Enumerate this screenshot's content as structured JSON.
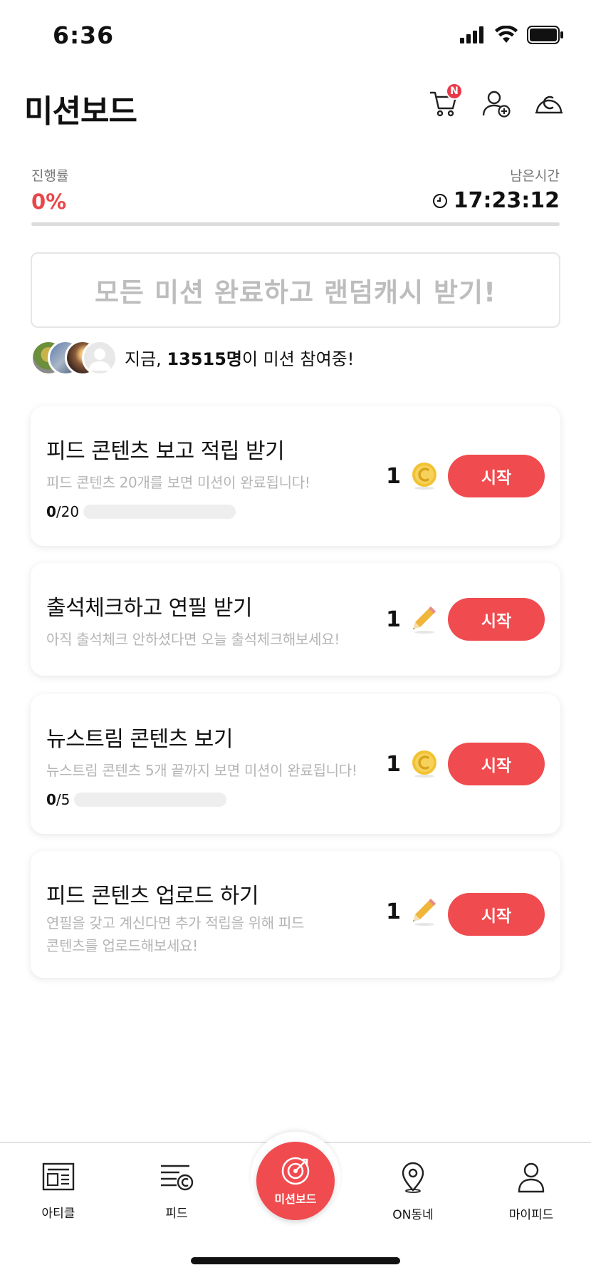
{
  "status_bar": {
    "time": "6:36"
  },
  "header": {
    "title": "미션보드",
    "cart_badge": "N"
  },
  "progress": {
    "label": "진행률",
    "value": "0%",
    "fraction": 0,
    "remaining_label": "남은시간",
    "remaining_time": "17:23:12"
  },
  "banner": {
    "text": "모든 미션 완료하고 랜덤캐시 받기!"
  },
  "participants": {
    "prefix": "지금, ",
    "count": "13515명",
    "suffix": "이 미션 참여중!"
  },
  "missions": [
    {
      "title": "피드 콘텐츠 보고 적립 받기",
      "desc": "피드 콘텐츠 20개를 보면 미션이 완료됩니다!",
      "progress_current": "0",
      "progress_total": "/20",
      "reward_amount": "1",
      "reward_icon": "coin-icon",
      "button": "시작"
    },
    {
      "title": "출석체크하고 연필 받기",
      "desc": "아직 출석체크 안하셨다면 오늘 출석체크해보세요!",
      "reward_amount": "1",
      "reward_icon": "pencil-icon",
      "button": "시작"
    },
    {
      "title": "뉴스트림 콘텐츠 보기",
      "desc": "뉴스트림 콘텐츠 5개 끝까지 보면 미션이 완료됩니다!",
      "progress_current": "0",
      "progress_total": "/5",
      "reward_amount": "1",
      "reward_icon": "coin-icon",
      "button": "시작"
    },
    {
      "title": "피드 콘텐츠 업로드 하기",
      "desc_line1": "연필을 갖고 계신다면 추가 적립을 위해 피드",
      "desc_line2": "콘텐츠를 업로드해보세요!",
      "reward_amount": "1",
      "reward_icon": "pencil-icon",
      "button": "시작"
    }
  ],
  "bottom_nav": {
    "items": [
      {
        "label": "아티클",
        "icon": "article-icon"
      },
      {
        "label": "피드",
        "icon": "feed-icon"
      },
      {
        "label": "미션보드",
        "icon": "target-icon"
      },
      {
        "label": "ON동네",
        "icon": "location-pin-icon"
      },
      {
        "label": "마이피드",
        "icon": "person-icon"
      }
    ]
  },
  "colors": {
    "accent": "#f04b4f",
    "progress_text": "#e8474a",
    "coin": "#f2c233",
    "pencil": "#f0b63a",
    "muted_text": "#b5b5b5"
  }
}
